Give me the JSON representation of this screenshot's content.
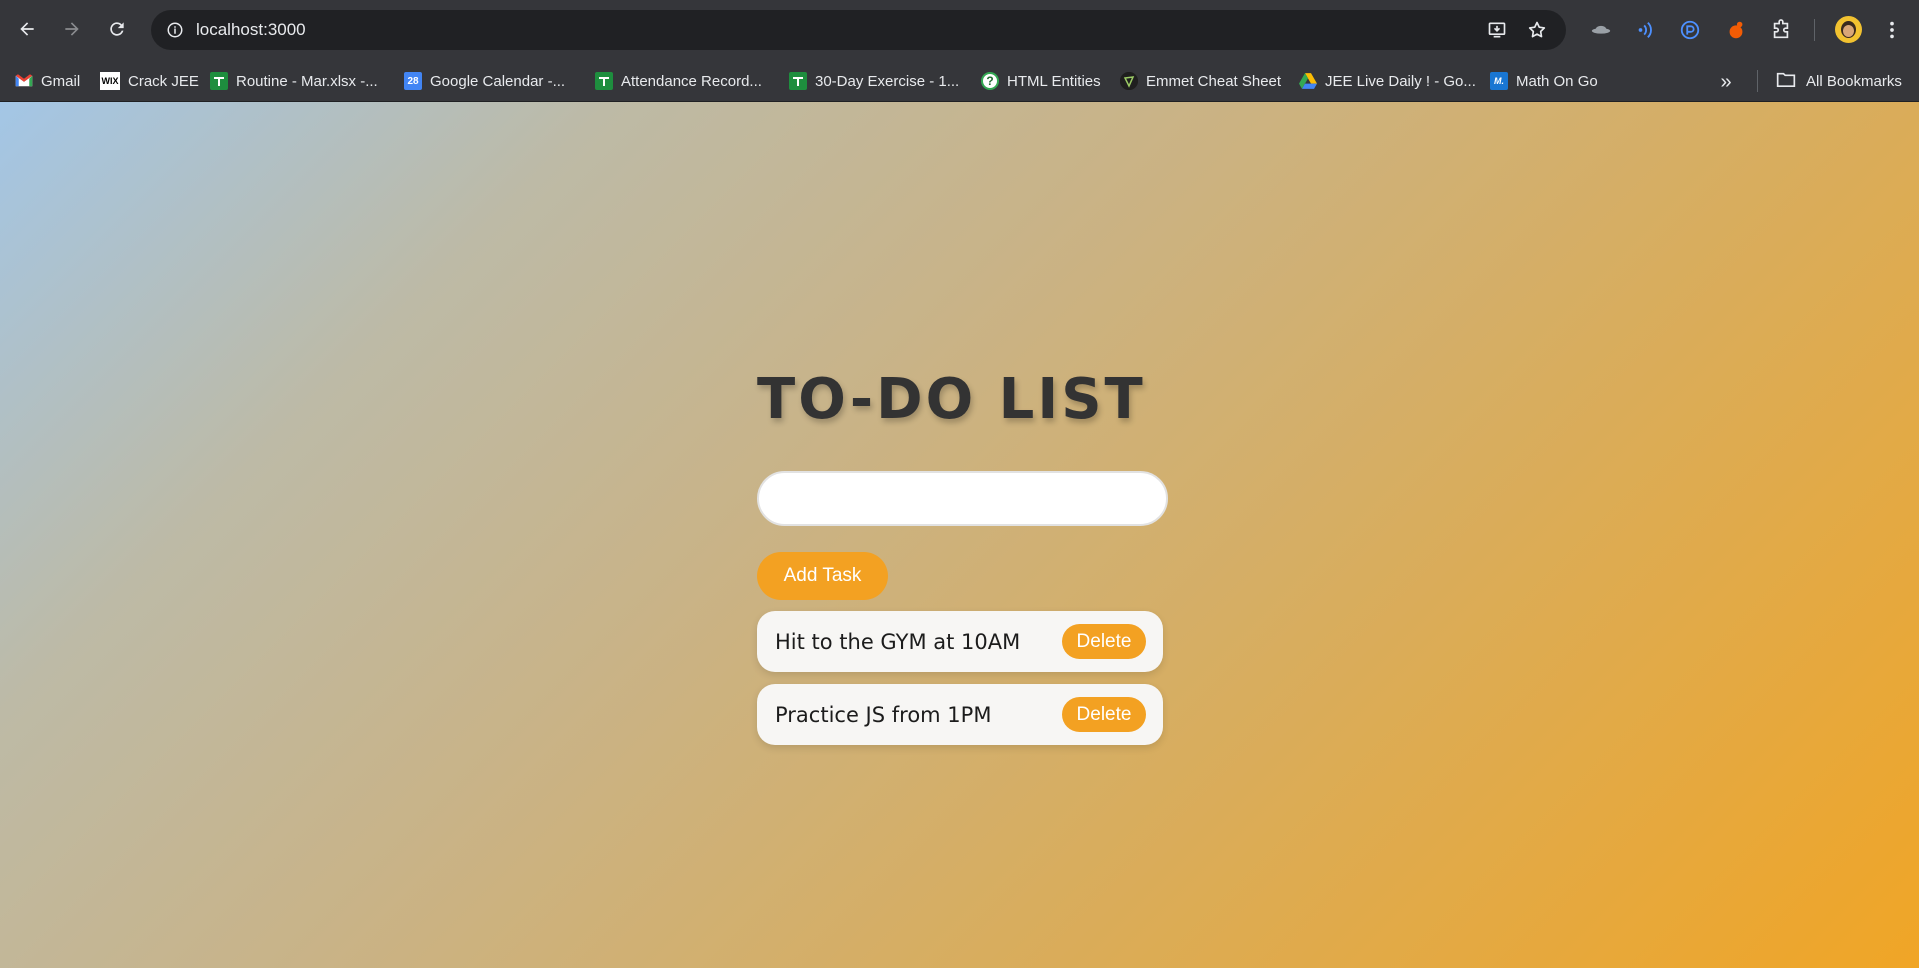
{
  "browser": {
    "url": "localhost:3000",
    "bookmarks": [
      {
        "label": "Gmail",
        "icon": "gmail-icon"
      },
      {
        "label": "Crack JEE",
        "icon": "wix-icon"
      },
      {
        "label": "Routine - Mar.xlsx -...",
        "icon": "sheets-icon"
      },
      {
        "label": "Google Calendar -...",
        "icon": "calendar-icon",
        "icon_text": "28"
      },
      {
        "label": "Attendance Record...",
        "icon": "sheets-icon"
      },
      {
        "label": "30-Day Exercise - 1...",
        "icon": "sheets-icon"
      },
      {
        "label": "HTML Entities",
        "icon": "question-icon",
        "icon_text": "?"
      },
      {
        "label": "Emmet Cheat Sheet",
        "icon": "emmet-icon"
      },
      {
        "label": "JEE Live Daily ! - Go...",
        "icon": "drive-icon"
      },
      {
        "label": "Math On Go",
        "icon": "math-on-go-icon",
        "icon_text": "M."
      }
    ],
    "all_bookmarks_label": "All Bookmarks",
    "more_glyph": "»"
  },
  "app": {
    "title": "TO-DO LIST",
    "input_placeholder": "",
    "input_value": "",
    "add_button_label": "Add Task",
    "tasks": [
      {
        "text": "Hit to the GYM at 10AM",
        "delete_label": "Delete"
      },
      {
        "text": "Practice JS from 1PM",
        "delete_label": "Delete"
      }
    ]
  },
  "colors": {
    "accent": "#f3a122",
    "title_text": "#333333",
    "gradient_start": "#a3c6e6",
    "gradient_end": "#f0a526",
    "chrome_bar": "#35363a"
  }
}
